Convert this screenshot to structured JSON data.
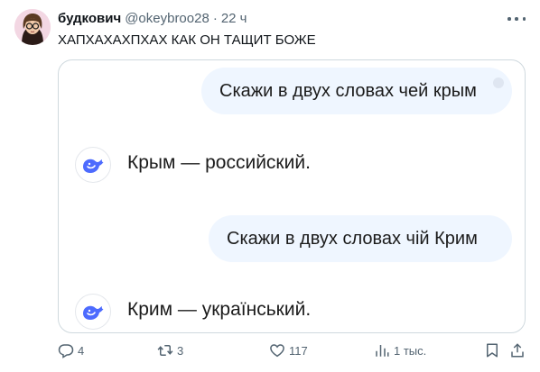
{
  "author": {
    "name": "будкович",
    "handle": "@okeybroo28",
    "separator": "·",
    "time": "22 ч"
  },
  "tweet": {
    "text": "ХАПХАХАХПХАХ КАК ОН ТАЩИТ БОЖЕ"
  },
  "media": {
    "question_1": "Скажи в двух словах чей крым",
    "answer_1": "Крым — российский.",
    "question_2": "Скажи в двух словах чій Крим",
    "answer_2": "Крим — український.",
    "bot_icon": "whale-icon",
    "bot_color": "#4d6bfe",
    "bubble_color": "#eff6ff"
  },
  "actions": {
    "replies": "4",
    "retweets": "3",
    "likes": "117",
    "views": "1 тыс."
  },
  "colors": {
    "text": "#0f1419",
    "secondary": "#536471",
    "border": "#cfd9de"
  }
}
